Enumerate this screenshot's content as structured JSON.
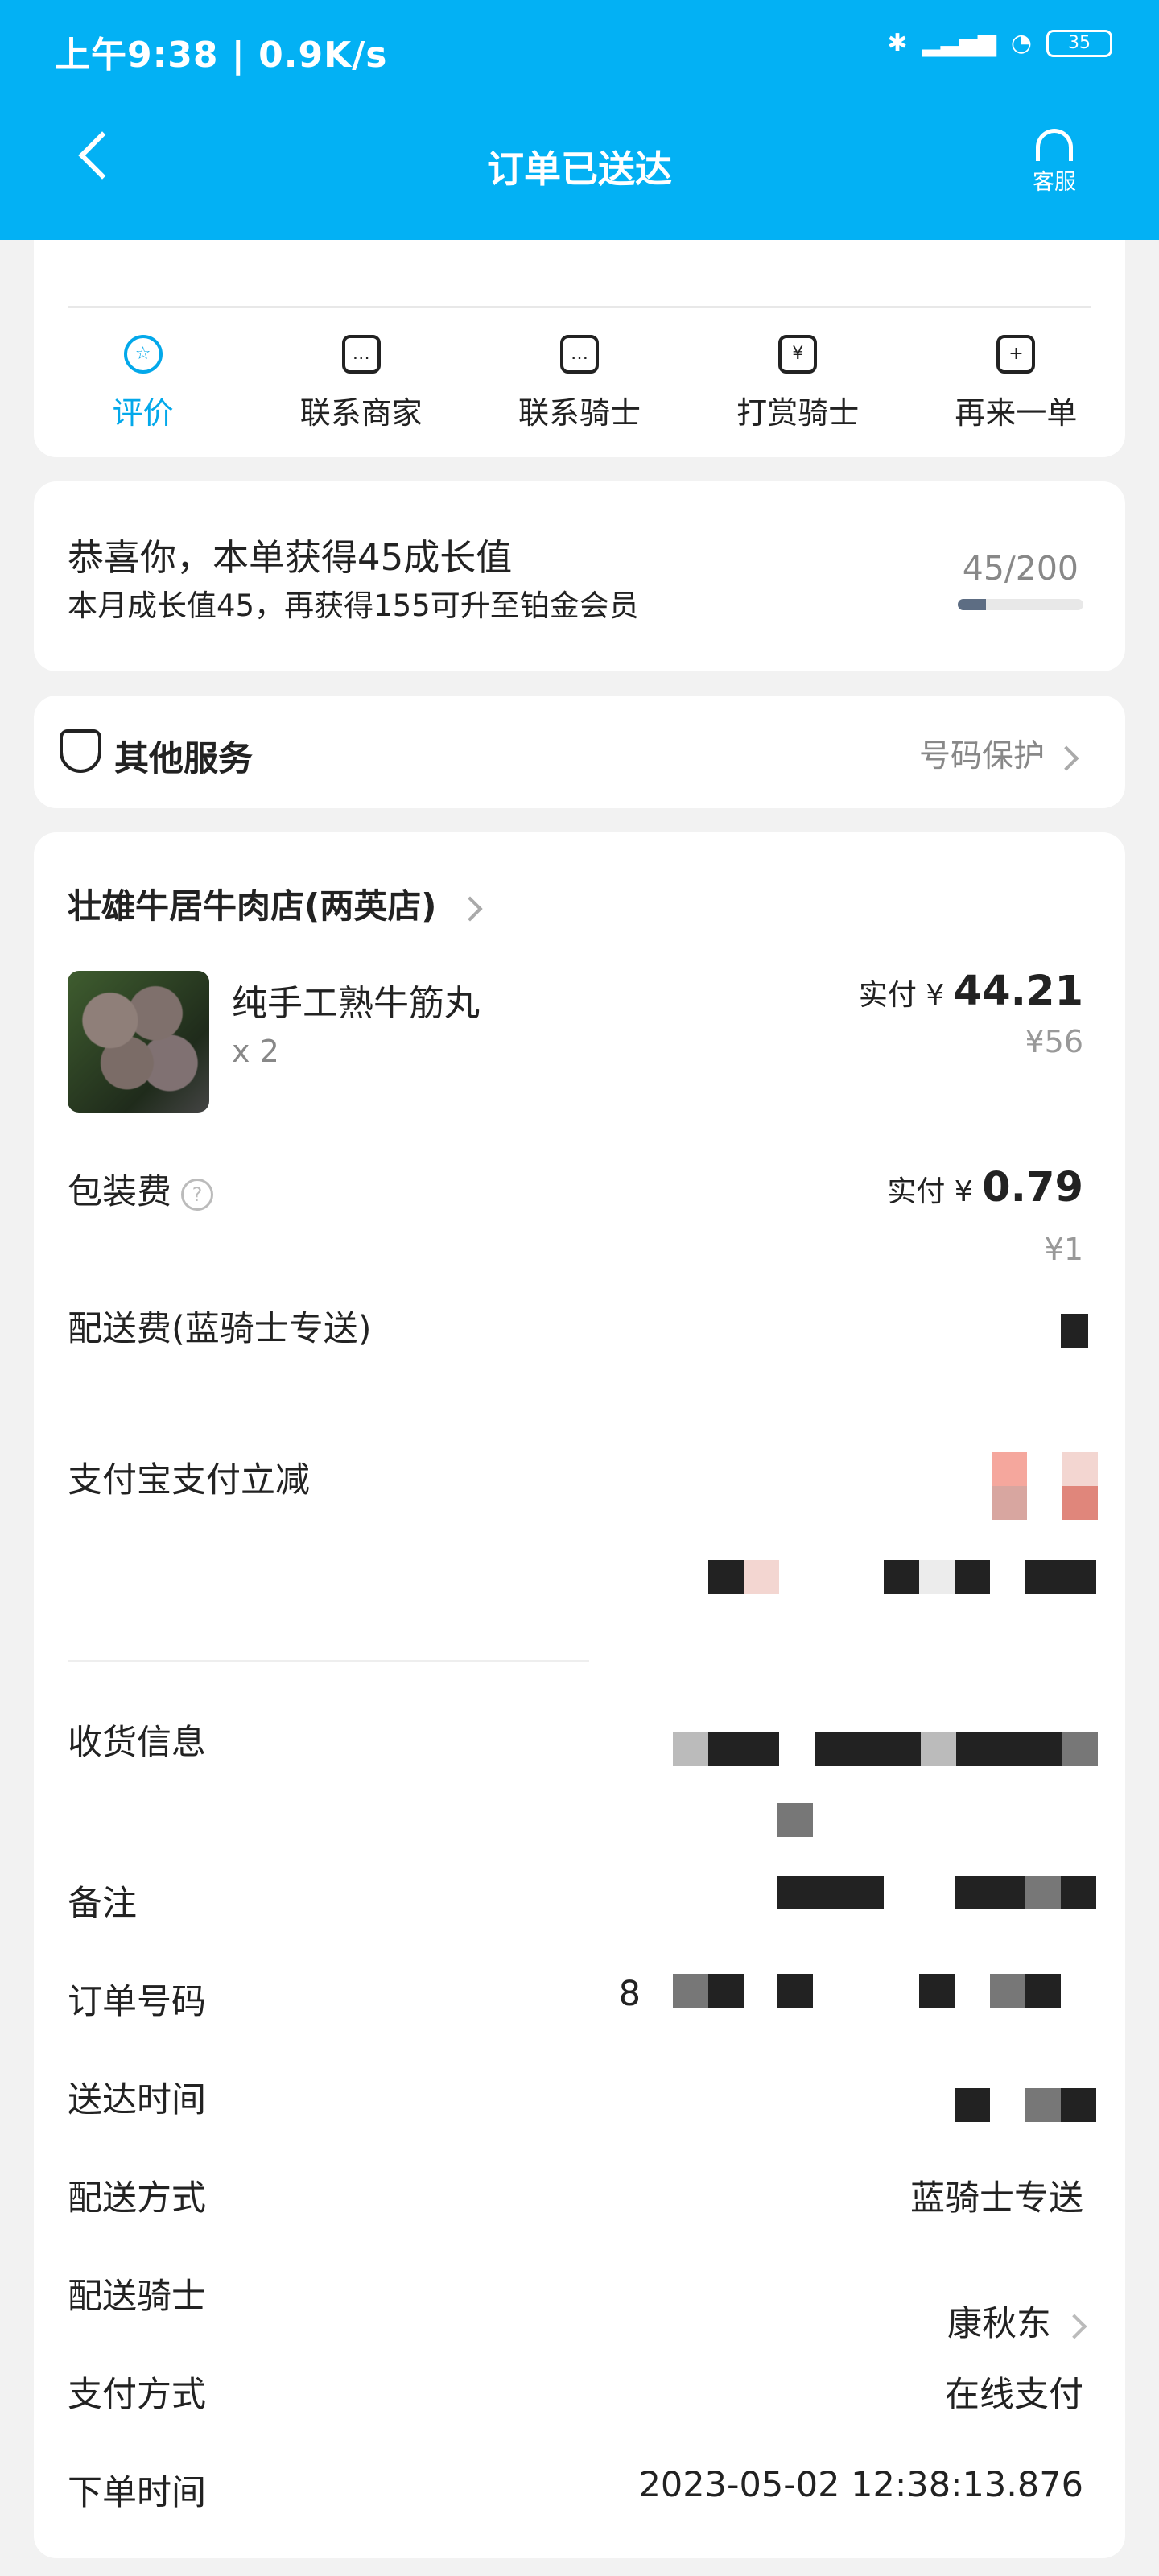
{
  "status_bar": {
    "time": "上午9:38 | 0.9K/s",
    "battery": "35"
  },
  "header": {
    "title": "订单已送达",
    "service": "客服"
  },
  "actions": [
    {
      "label": "评价"
    },
    {
      "label": "联系商家"
    },
    {
      "label": "联系骑士"
    },
    {
      "label": "打赏骑士"
    },
    {
      "label": "再来一单"
    }
  ],
  "growth": {
    "title": "恭喜你，本单获得45成长值",
    "subtitle": "本月成长值45，再获得155可升至铂金会员",
    "progress_text": "45/200",
    "progress_value": 0.225
  },
  "other_services": {
    "title": "其他服务",
    "right": "号码保护"
  },
  "store": {
    "name": "壮雄牛居牛肉店(两英店)"
  },
  "item": {
    "name": "纯手工熟牛筋丸",
    "qty": "x 2",
    "paid_label": "实付",
    "paid_currency": "¥",
    "paid_amount": "44.21",
    "original": "¥56"
  },
  "packaging": {
    "label": "包装费",
    "paid_label": "实付",
    "paid_currency": "¥",
    "paid_amount": "0.79",
    "original": "¥1"
  },
  "delivery_fee": {
    "label": "配送费(蓝骑士专送)"
  },
  "alipay_discount": {
    "label": "支付宝支付立减"
  },
  "details": {
    "receive_info": "收货信息",
    "remark": "备注",
    "order_no_label": "订单号码",
    "order_no_prefix": "8",
    "delivered_time": "送达时间",
    "delivery_method_label": "配送方式",
    "delivery_method_value": "蓝骑士专送",
    "rider_label": "配送骑士",
    "rider_value": "康秋东",
    "payment_method_label": "支付方式",
    "payment_method_value": "在线支付",
    "order_time_label": "下单时间",
    "order_time_value": "2023-05-02 12:38:13.876"
  }
}
